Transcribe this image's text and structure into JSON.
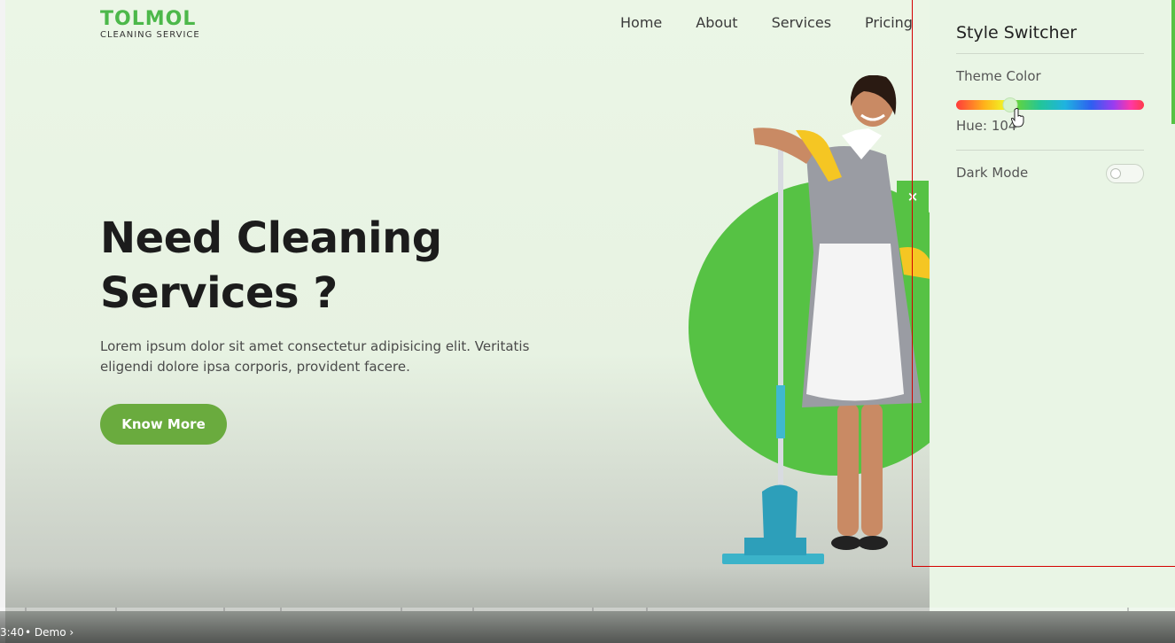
{
  "brand": {
    "name": "TOLMOL",
    "tagline": "CLEANING SERVICE",
    "color": "#4cb84a"
  },
  "nav": {
    "items": [
      "Home",
      "About",
      "Services",
      "Pricing"
    ]
  },
  "hero": {
    "title": "Need Cleaning Services ?",
    "text": "Lorem ipsum dolor sit amet consectetur adipisicing elit. Veritatis eligendi dolore ipsa corporis, provident facere.",
    "button_label": "Know More",
    "button_color": "#6aab3e",
    "circle_color": "#56c244"
  },
  "close_label": "×",
  "switcher": {
    "title": "Style Switcher",
    "theme_label": "Theme Color",
    "hue_label": "Hue: 104",
    "hue_value": 104,
    "dark_mode_label": "Dark Mode",
    "dark_mode_on": false
  },
  "video": {
    "time": "3:40",
    "separator": "•",
    "chapter": "Demo ›"
  }
}
